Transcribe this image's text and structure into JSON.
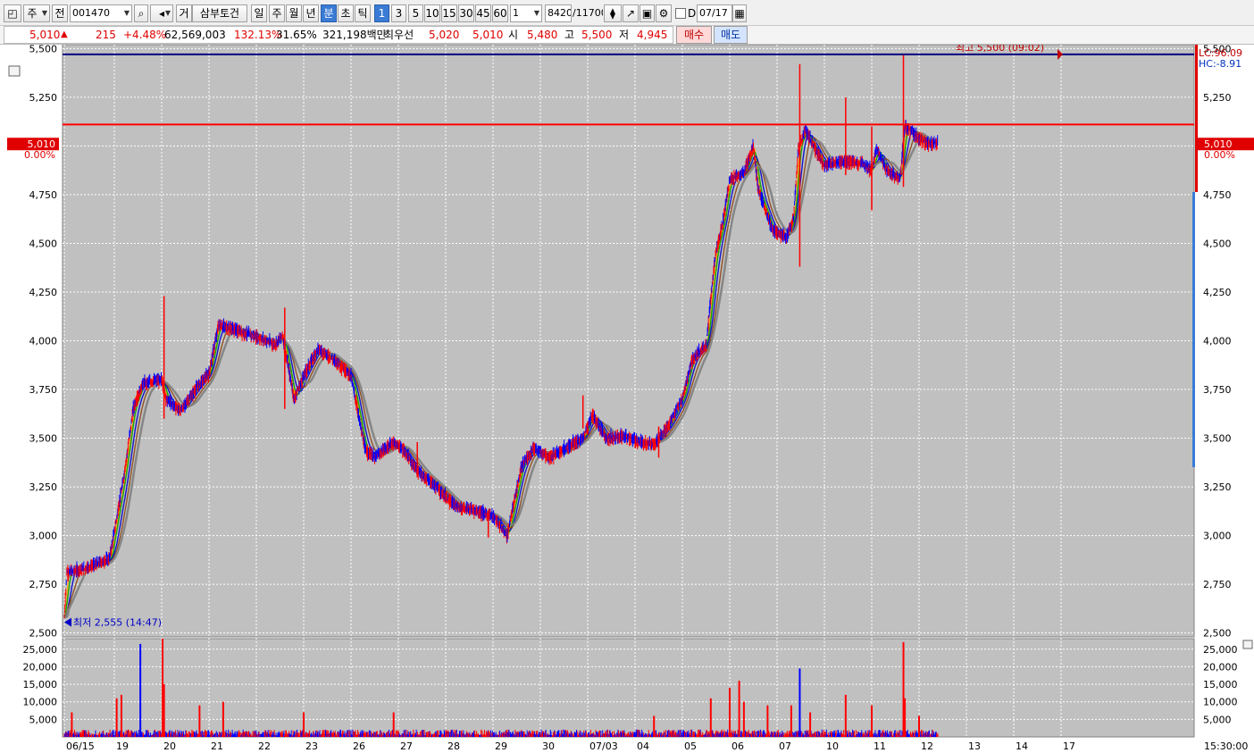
{
  "toolbar": {
    "market_label": "주",
    "all_label": "전",
    "stock_code": "001470",
    "name_prefix": "거",
    "stock_name": "삼부토건",
    "periods": [
      "일",
      "주",
      "월",
      "년",
      "분",
      "초",
      "틱"
    ],
    "selected_period": "분",
    "intervals": [
      "1",
      "3",
      "5",
      "10",
      "15",
      "30",
      "45",
      "60"
    ],
    "selected_interval": "1",
    "multiplier": "1",
    "count_current": "8420",
    "count_total": "/11700",
    "checkbox_label": "D",
    "date": "07/17"
  },
  "quote": {
    "price": "5,010",
    "change": "215",
    "change_rate": "+4.48%",
    "volume": "62,569,003",
    "volume_ratio": "132.13%",
    "turnover_rate": "31.65%",
    "amount": "321,198백만",
    "best_label": "최우선",
    "best_ask": "5,020",
    "best_bid": "5,010",
    "open_label": "시",
    "open": "5,480",
    "high_label": "고",
    "high": "5,500",
    "low_label": "저",
    "low": "4,945",
    "buy_label": "매수",
    "sell_label": "매도"
  },
  "chart_data": {
    "type": "candlestick",
    "price_axis": {
      "min": 2480,
      "max": 5520,
      "ticks": [
        2500,
        2750,
        3000,
        3250,
        3500,
        3750,
        4000,
        4250,
        4500,
        4750,
        5000,
        5250,
        5500
      ],
      "tick_labels": [
        "2,500",
        "2,750",
        "3,000",
        "3,250",
        "3,500",
        "3,750",
        "4,000",
        "4,250",
        "4,500",
        "4,750",
        "5,000",
        "5,250",
        "5,500"
      ]
    },
    "volume_axis": {
      "max": 28000,
      "ticks": [
        5000,
        10000,
        15000,
        20000,
        25000
      ],
      "tick_labels": [
        "5,000",
        "10,000",
        "15,000",
        "20,000",
        "25,000"
      ]
    },
    "dates": [
      "06/15",
      "19",
      "20",
      "21",
      "22",
      "23",
      "26",
      "27",
      "28",
      "29",
      "30",
      "07/03",
      "04",
      "05",
      "06",
      "07",
      "10",
      "11",
      "12",
      "13",
      "14",
      "17"
    ],
    "close_path": [
      [
        0,
        2580
      ],
      [
        0.05,
        2810
      ],
      [
        0.4,
        2830
      ],
      [
        0.9,
        2880
      ],
      [
        1.2,
        3300
      ],
      [
        1.4,
        3650
      ],
      [
        1.6,
        3780
      ],
      [
        2.0,
        3800
      ],
      [
        2.1,
        3700
      ],
      [
        2.4,
        3640
      ],
      [
        2.8,
        3780
      ],
      [
        3.0,
        3830
      ],
      [
        3.2,
        4080
      ],
      [
        3.5,
        4060
      ],
      [
        4.0,
        4020
      ],
      [
        4.4,
        3980
      ],
      [
        4.55,
        4030
      ],
      [
        4.8,
        3700
      ],
      [
        5.0,
        3820
      ],
      [
        5.3,
        3960
      ],
      [
        5.7,
        3890
      ],
      [
        6.0,
        3820
      ],
      [
        6.3,
        3440
      ],
      [
        6.5,
        3400
      ],
      [
        6.9,
        3480
      ],
      [
        7.1,
        3440
      ],
      [
        7.4,
        3330
      ],
      [
        7.8,
        3250
      ],
      [
        8.2,
        3150
      ],
      [
        8.6,
        3130
      ],
      [
        9.0,
        3100
      ],
      [
        9.3,
        3000
      ],
      [
        9.6,
        3350
      ],
      [
        9.85,
        3450
      ],
      [
        10.2,
        3400
      ],
      [
        10.6,
        3460
      ],
      [
        10.9,
        3500
      ],
      [
        11.1,
        3620
      ],
      [
        11.4,
        3500
      ],
      [
        11.8,
        3510
      ],
      [
        12.1,
        3480
      ],
      [
        12.4,
        3470
      ],
      [
        12.7,
        3560
      ],
      [
        13.0,
        3700
      ],
      [
        13.2,
        3900
      ],
      [
        13.5,
        3980
      ],
      [
        13.7,
        4450
      ],
      [
        13.85,
        4600
      ],
      [
        14.0,
        4830
      ],
      [
        14.3,
        4860
      ],
      [
        14.5,
        5000
      ],
      [
        14.6,
        4780
      ],
      [
        14.9,
        4570
      ],
      [
        15.2,
        4530
      ],
      [
        15.35,
        4630
      ],
      [
        15.45,
        4990
      ],
      [
        15.6,
        5080
      ],
      [
        16.0,
        4900
      ],
      [
        16.4,
        4920
      ],
      [
        16.8,
        4910
      ],
      [
        17.0,
        4870
      ],
      [
        17.1,
        4990
      ],
      [
        17.3,
        4880
      ],
      [
        17.6,
        4830
      ],
      [
        17.7,
        5100
      ],
      [
        18.0,
        5040
      ],
      [
        18.2,
        5010
      ],
      [
        18.4,
        5020
      ]
    ],
    "wick_spikes": [
      {
        "x": 2.05,
        "low": 3600,
        "high": 4230
      },
      {
        "x": 4.6,
        "low": 3650,
        "high": 4170
      },
      {
        "x": 7.4,
        "low": 3300,
        "high": 3480
      },
      {
        "x": 8.9,
        "low": 2990,
        "high": 3120
      },
      {
        "x": 10.9,
        "low": 3550,
        "high": 3720
      },
      {
        "x": 12.5,
        "low": 3400,
        "high": 3560
      },
      {
        "x": 15.48,
        "low": 4380,
        "high": 5420
      },
      {
        "x": 16.45,
        "low": 4850,
        "high": 5250
      },
      {
        "x": 17.0,
        "low": 4670,
        "high": 5100
      },
      {
        "x": 17.67,
        "low": 4790,
        "high": 5470
      }
    ],
    "horizontal_lines": [
      {
        "value": 5470,
        "color": "#000080",
        "label": "최고 5,500 (09:02)"
      },
      {
        "value": 5110,
        "color": "#ff0000",
        "label": ""
      }
    ],
    "low_annotation": "최저 2,555 (14:47)",
    "current_price_label": "5,010",
    "current_change_label": "0.00%",
    "lc_label": "LC:96.09",
    "hc_label": "HC:-8.91",
    "time_label": "15:30:00",
    "volume_spikes": [
      {
        "x": 1.55,
        "v": 26500
      },
      {
        "x": 2.02,
        "v": 28000
      },
      {
        "x": 2.05,
        "v": 15000
      },
      {
        "x": 1.15,
        "v": 12000
      },
      {
        "x": 1.05,
        "v": 11000
      },
      {
        "x": 3.3,
        "v": 10000
      },
      {
        "x": 2.8,
        "v": 9000
      },
      {
        "x": 0.15,
        "v": 7000
      },
      {
        "x": 14.2,
        "v": 16000
      },
      {
        "x": 14.0,
        "v": 14000
      },
      {
        "x": 14.3,
        "v": 10000
      },
      {
        "x": 13.6,
        "v": 11000
      },
      {
        "x": 14.8,
        "v": 9000
      },
      {
        "x": 15.48,
        "v": 19500
      },
      {
        "x": 15.3,
        "v": 9000
      },
      {
        "x": 15.7,
        "v": 7000
      },
      {
        "x": 16.45,
        "v": 12000
      },
      {
        "x": 17.0,
        "v": 9000
      },
      {
        "x": 17.67,
        "v": 27000
      },
      {
        "x": 17.7,
        "v": 11000
      },
      {
        "x": 18.0,
        "v": 6000
      },
      {
        "x": 5.0,
        "v": 7000
      },
      {
        "x": 6.9,
        "v": 7000
      },
      {
        "x": 12.4,
        "v": 6000
      }
    ],
    "colors": {
      "up": "#ff0000",
      "down": "#0000ff",
      "background": "#c0c0c0",
      "ma_colors": [
        "#ffa500",
        "#00a000",
        "#0000c8",
        "#8b4513",
        "#808080"
      ]
    }
  }
}
